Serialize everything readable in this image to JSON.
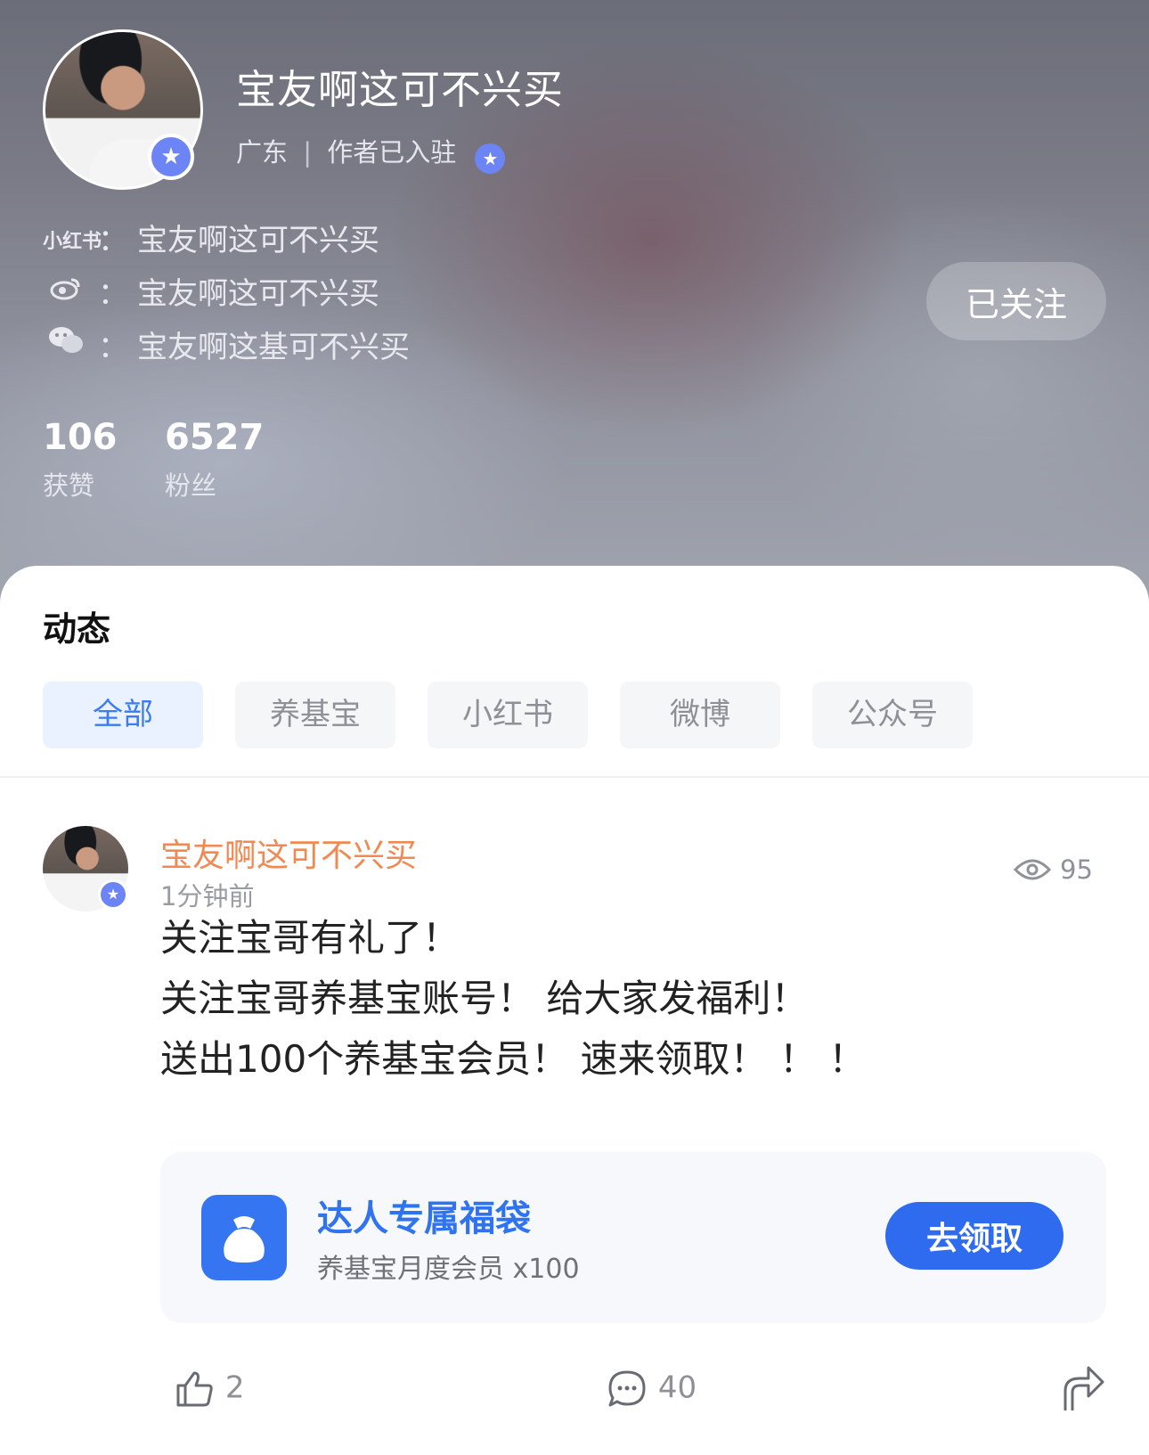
{
  "profile": {
    "name": "宝友啊这可不兴买",
    "location": "广东",
    "separator": "|",
    "author_status": "作者已入驻",
    "verified_glyph": "★",
    "follow_button": "已关注",
    "socials": [
      {
        "platform_icon": "小红书",
        "colon": "：",
        "handle": "宝友啊这可不兴买"
      },
      {
        "platform_icon": "weibo-icon",
        "colon": "：",
        "handle": "宝友啊这可不兴买"
      },
      {
        "platform_icon": "wechat-icon",
        "colon": "：",
        "handle": "宝友啊这基可不兴买"
      }
    ],
    "stats": [
      {
        "value": "106",
        "label": "获赞"
      },
      {
        "value": "6527",
        "label": "粉丝"
      }
    ]
  },
  "feed": {
    "section_title": "动态",
    "tabs": [
      "全部",
      "养基宝",
      "小红书",
      "微博",
      "公众号"
    ],
    "active_tab": "全部"
  },
  "post": {
    "author": "宝友啊这可不兴买",
    "time": "1分钟前",
    "views": "95",
    "lines": [
      "关注宝哥有礼了！",
      "关注宝哥养基宝账号！ 给大家发福利！",
      "送出100个养基宝会员！ 速来领取！ ！ ！"
    ],
    "reward_card": {
      "title": "达人专属福袋",
      "subtitle": "养基宝月度会员 x100",
      "button": "去领取"
    },
    "likes": "2",
    "comments": "40"
  },
  "colors": {
    "accent_blue": "#2F6BEF",
    "author_orange": "#F08A52",
    "badge_blue": "#6D85F4"
  }
}
